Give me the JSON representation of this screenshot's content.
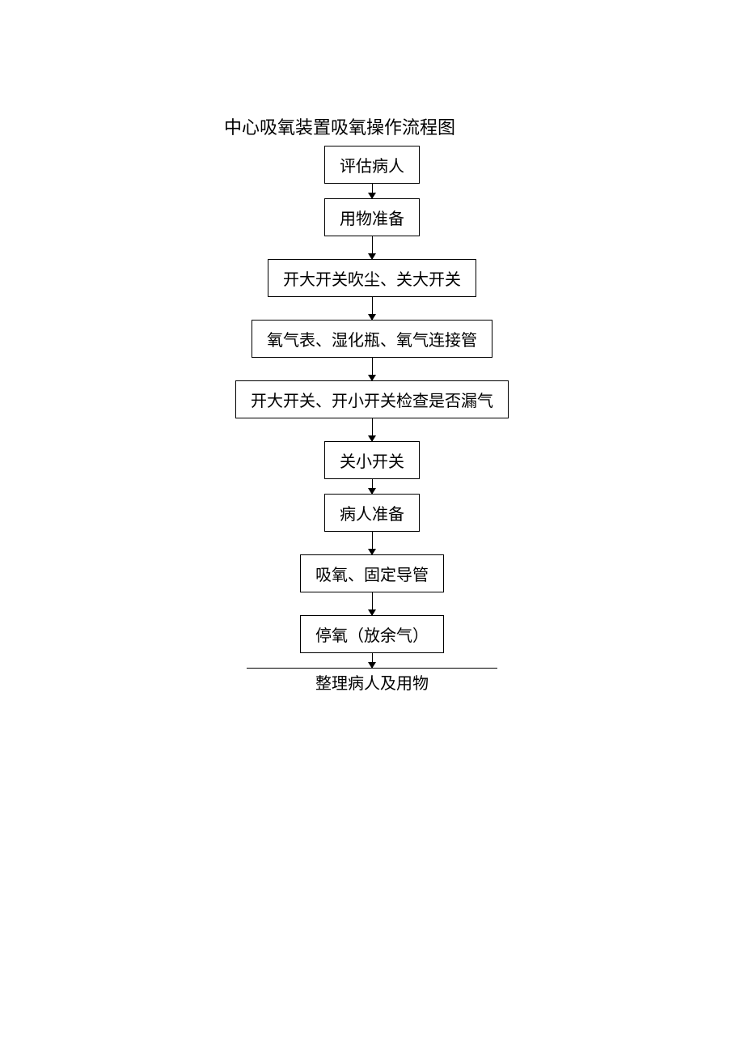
{
  "title": "中心吸氧装置吸氧操作流程图",
  "steps": [
    "评估病人",
    "用物准备",
    "开大开关吹尘、关大开关",
    "氧气表、湿化瓶、氧气连接管",
    "开大开关、开小开关检查是否漏气",
    "关小开关",
    "病人准备",
    "吸氧、固定导管",
    "停氧（放余气）"
  ],
  "final": "整理病人及用物"
}
